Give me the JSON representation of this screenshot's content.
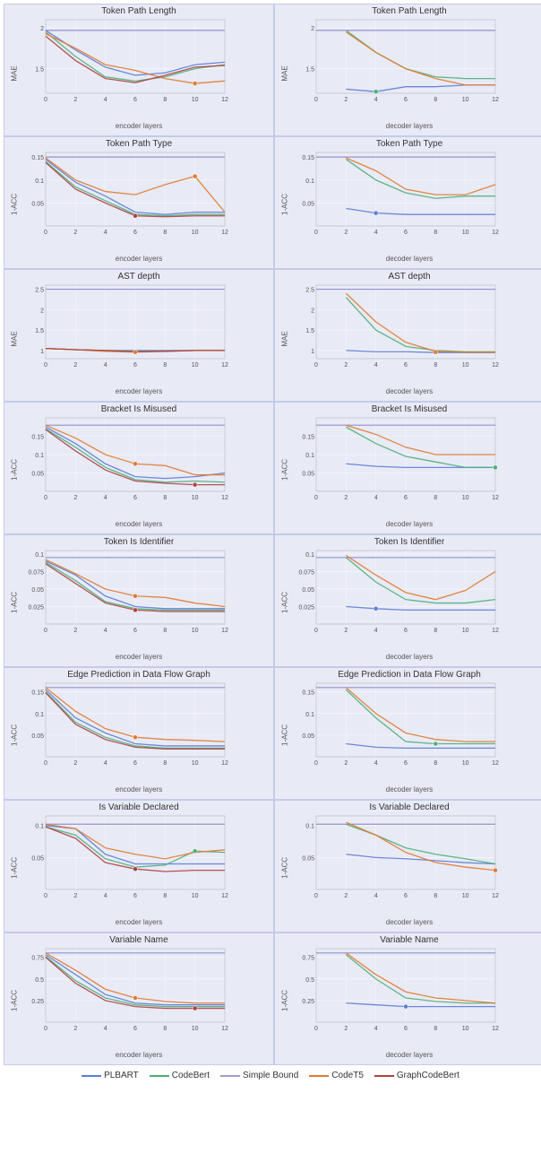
{
  "charts": [
    {
      "id": "tpl-enc",
      "title": "Token Path Length",
      "yLabel": "MAE",
      "xLabel": "encoder layers",
      "yRange": [
        1.2,
        2.1
      ],
      "xRange": [
        0,
        12
      ],
      "yTicks": [
        1.5,
        2.0
      ],
      "xTicks": [
        0,
        2,
        4,
        6,
        8,
        10,
        12
      ]
    },
    {
      "id": "tpl-dec",
      "title": "Token Path Length",
      "yLabel": "MAE",
      "xLabel": "decoder layers",
      "yRange": [
        1.2,
        2.1
      ],
      "xRange": [
        0,
        12
      ],
      "yTicks": [
        1.5,
        2.0
      ],
      "xTicks": [
        0,
        2,
        4,
        6,
        8,
        10,
        12
      ]
    },
    {
      "id": "tpt-enc",
      "title": "Token Path Type",
      "yLabel": "1-ACC",
      "xLabel": "encoder layers",
      "yRange": [
        0,
        0.16
      ],
      "xRange": [
        0,
        12
      ],
      "yTicks": [
        0.05,
        0.1,
        0.15
      ],
      "xTicks": [
        0,
        2,
        4,
        6,
        8,
        10,
        12
      ]
    },
    {
      "id": "tpt-dec",
      "title": "Token Path Type",
      "yLabel": "1-ACC",
      "xLabel": "decoder layers",
      "yRange": [
        0,
        0.16
      ],
      "xRange": [
        0,
        12
      ],
      "yTicks": [
        0.05,
        0.1,
        0.15
      ],
      "xTicks": [
        0,
        2,
        4,
        6,
        8,
        10,
        12
      ]
    },
    {
      "id": "ast-enc",
      "title": "AST depth",
      "yLabel": "MAE",
      "xLabel": "encoder layers",
      "yRange": [
        0.8,
        2.6
      ],
      "xRange": [
        0,
        12
      ],
      "yTicks": [
        1.0,
        1.5,
        2.0,
        2.5
      ],
      "xTicks": [
        0,
        2,
        4,
        6,
        8,
        10,
        12
      ]
    },
    {
      "id": "ast-dec",
      "title": "AST depth",
      "yLabel": "MAE",
      "xLabel": "decoder layers",
      "yRange": [
        0.8,
        2.6
      ],
      "xRange": [
        0,
        12
      ],
      "yTicks": [
        1.0,
        1.5,
        2.0,
        2.5
      ],
      "xTicks": [
        0,
        2,
        4,
        6,
        8,
        10,
        12
      ]
    },
    {
      "id": "bim-enc",
      "title": "Bracket Is Misused",
      "yLabel": "1-ACC",
      "xLabel": "encoder layers",
      "yRange": [
        0,
        0.2
      ],
      "xRange": [
        0,
        12
      ],
      "yTicks": [
        0.05,
        0.1,
        0.15
      ],
      "xTicks": [
        0,
        2,
        4,
        6,
        8,
        10,
        12
      ]
    },
    {
      "id": "bim-dec",
      "title": "Bracket Is Misused",
      "yLabel": "1-ACC",
      "xLabel": "decoder layers",
      "yRange": [
        0,
        0.2
      ],
      "xRange": [
        0,
        12
      ],
      "yTicks": [
        0.05,
        0.1,
        0.15
      ],
      "xTicks": [
        0,
        2,
        4,
        6,
        8,
        10,
        12
      ]
    },
    {
      "id": "tii-enc",
      "title": "Token Is Identifier",
      "yLabel": "1-ACC",
      "xLabel": "encoder layers",
      "yRange": [
        0,
        0.105
      ],
      "xRange": [
        0,
        12
      ],
      "yTicks": [
        0.025,
        0.05,
        0.075,
        0.1
      ],
      "xTicks": [
        0,
        2,
        4,
        6,
        8,
        10,
        12
      ]
    },
    {
      "id": "tii-dec",
      "title": "Token Is Identifier",
      "yLabel": "1-ACC",
      "xLabel": "decoder layers",
      "yRange": [
        0,
        0.105
      ],
      "xRange": [
        0,
        12
      ],
      "yTicks": [
        0.025,
        0.05,
        0.075,
        0.1
      ],
      "xTicks": [
        0,
        2,
        4,
        6,
        8,
        10,
        12
      ]
    },
    {
      "id": "edfg-enc",
      "title": "Edge Prediction in Data Flow Graph",
      "yLabel": "1-ACC",
      "xLabel": "encoder layers",
      "yRange": [
        0,
        0.17
      ],
      "xRange": [
        0,
        12
      ],
      "yTicks": [
        0.05,
        0.1,
        0.15
      ],
      "xTicks": [
        0,
        2,
        4,
        6,
        8,
        10,
        12
      ]
    },
    {
      "id": "edfg-dec",
      "title": "Edge Prediction in Data Flow Graph",
      "yLabel": "1-ACC",
      "xLabel": "decoder layers",
      "yRange": [
        0,
        0.17
      ],
      "xRange": [
        0,
        12
      ],
      "yTicks": [
        0.05,
        0.1,
        0.15
      ],
      "xTicks": [
        0,
        2,
        4,
        6,
        8,
        10,
        12
      ]
    },
    {
      "id": "ivd-enc",
      "title": "Is Variable Declared",
      "yLabel": "1-ACC",
      "xLabel": "encoder layers",
      "yRange": [
        0,
        0.115
      ],
      "xRange": [
        0,
        12
      ],
      "yTicks": [
        0.05,
        0.1
      ],
      "xTicks": [
        0,
        2,
        4,
        6,
        8,
        10,
        12
      ]
    },
    {
      "id": "ivd-dec",
      "title": "Is Variable Declared",
      "yLabel": "1-ACC",
      "xLabel": "decoder layers",
      "yRange": [
        0,
        0.115
      ],
      "xRange": [
        0,
        12
      ],
      "yTicks": [
        0.05,
        0.1
      ],
      "xTicks": [
        0,
        2,
        4,
        6,
        8,
        10,
        12
      ]
    },
    {
      "id": "vn-enc",
      "title": "Variable Name",
      "yLabel": "1-ACC",
      "xLabel": "encoder layers",
      "yRange": [
        0,
        0.85
      ],
      "xRange": [
        0,
        12
      ],
      "yTicks": [
        0.25,
        0.5,
        0.75
      ],
      "xTicks": [
        0,
        2,
        4,
        6,
        8,
        10,
        12
      ]
    },
    {
      "id": "vn-dec",
      "title": "Variable Name",
      "yLabel": "1-ACC",
      "xLabel": "decoder layers",
      "yRange": [
        0,
        0.85
      ],
      "xRange": [
        0,
        12
      ],
      "yTicks": [
        0.25,
        0.5,
        0.75
      ],
      "xTicks": [
        0,
        2,
        4,
        6,
        8,
        10,
        12
      ]
    }
  ],
  "legend": {
    "items": [
      {
        "label": "PLBART",
        "color": "#5c7dd4",
        "type": "solid"
      },
      {
        "label": "CodeBert",
        "color": "#4caf78",
        "type": "solid"
      },
      {
        "label": "Simple Bound",
        "color": "#9e9ecc",
        "type": "solid"
      },
      {
        "label": "CodeT5",
        "color": "#e07a30",
        "type": "solid"
      },
      {
        "label": "GraphCodeBert",
        "color": "#b04040",
        "type": "solid"
      }
    ]
  },
  "colors": {
    "plbart": "#5c7dd4",
    "codebert": "#4caf78",
    "codet5": "#e07a30",
    "graphcodebert": "#b04040",
    "simplebound": "#8888cc",
    "background": "#e8eaf6",
    "gridline": "#ffffff"
  }
}
